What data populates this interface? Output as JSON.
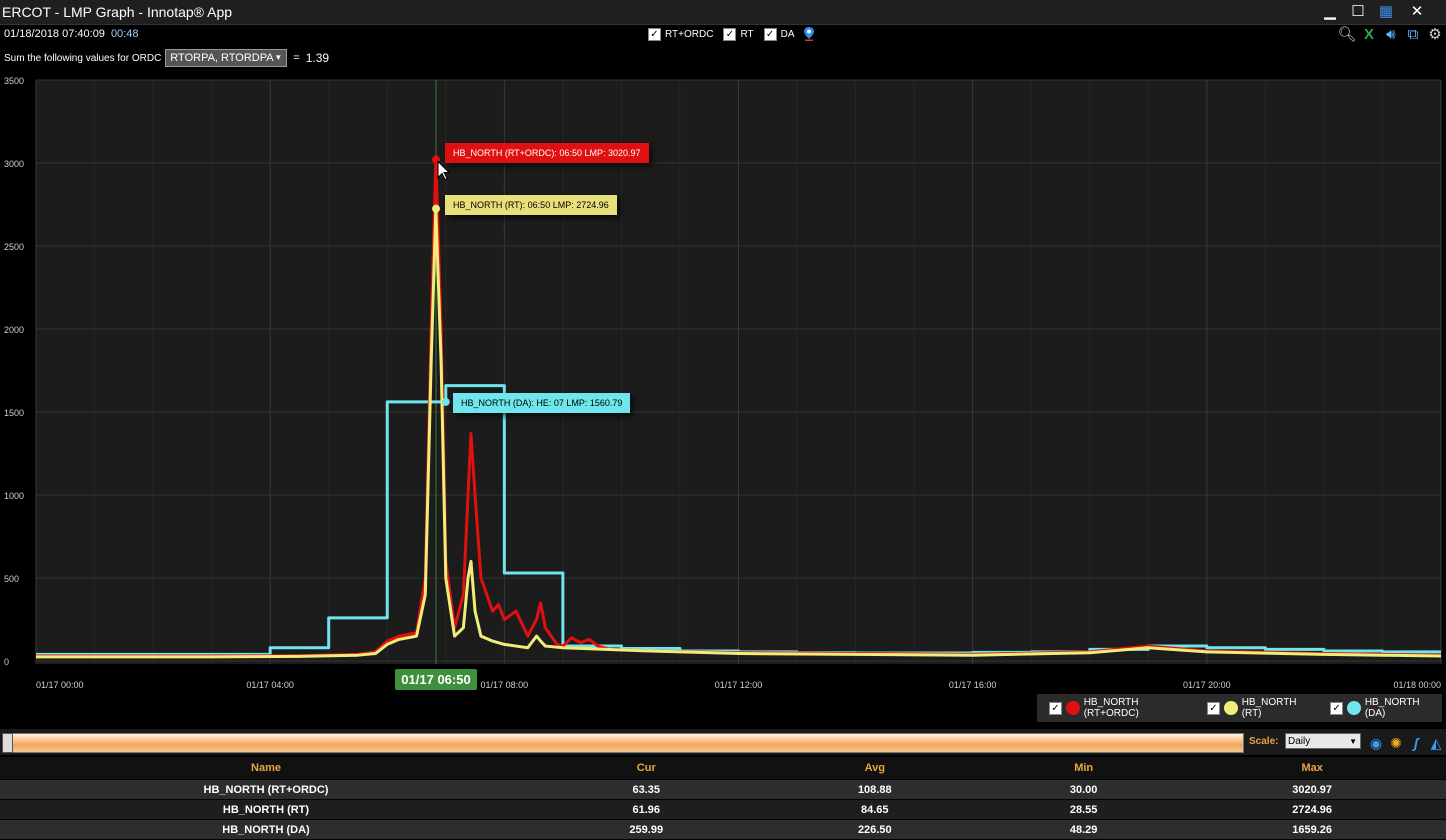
{
  "window": {
    "title": "ERCOT - LMP Graph - Innotap® App",
    "minimize": "▁",
    "maximize": "☐",
    "tile": "▦",
    "close": "✕"
  },
  "toolbar": {
    "datetime": "01/18/2018 07:40:09",
    "elapsed": "00:48",
    "checks": [
      {
        "label": "RT+ORDC",
        "checked": true
      },
      {
        "label": "RT",
        "checked": true
      },
      {
        "label": "DA",
        "checked": true
      }
    ],
    "ordc_label": "Sum the following values for ORDC",
    "ordc_selected": "RTORPA, RTORDPA",
    "equals": "=",
    "ordc_sum": "1.39",
    "icons": [
      "search-icon",
      "excel-icon",
      "sound-icon",
      "export-icon",
      "settings-icon"
    ]
  },
  "hover": {
    "time_label": "01/17 06:50",
    "tooltips": {
      "rt_ordc": "HB_NORTH (RT+ORDC): 06:50 LMP: 3020.97",
      "rt": "HB_NORTH (RT): 06:50 LMP: 2724.96",
      "da": "HB_NORTH (DA): HE: 07 LMP: 1560.79"
    }
  },
  "chart_data": {
    "type": "line",
    "title": "",
    "xlabel": "",
    "ylabel": "",
    "xlim_hours": [
      0,
      24
    ],
    "ylim": [
      0,
      3500
    ],
    "yticks": [
      0,
      500,
      1000,
      1500,
      2000,
      2500,
      3000,
      3500
    ],
    "xticks": [
      {
        "h": 0,
        "label": "01/17 00:00"
      },
      {
        "h": 4,
        "label": "01/17 04:00"
      },
      {
        "h": 8,
        "label": "01/17 08:00"
      },
      {
        "h": 12,
        "label": "01/17 12:00"
      },
      {
        "h": 16,
        "label": "01/17 16:00"
      },
      {
        "h": 20,
        "label": "01/17 20:00"
      },
      {
        "h": 24,
        "label": "01/18 00:00"
      }
    ],
    "grid": true,
    "legend_position": "bottom-right",
    "series": [
      {
        "name": "HB_NORTH (RT+ORDC)",
        "color": "#e01010",
        "step": false,
        "points": [
          [
            0,
            30
          ],
          [
            3,
            30
          ],
          [
            4.5,
            32
          ],
          [
            5.5,
            40
          ],
          [
            5.8,
            55
          ],
          [
            6.0,
            120
          ],
          [
            6.2,
            150
          ],
          [
            6.5,
            170
          ],
          [
            6.65,
            500
          ],
          [
            6.75,
            2000
          ],
          [
            6.83,
            3020.97
          ],
          [
            6.92,
            2000
          ],
          [
            7.0,
            600
          ],
          [
            7.15,
            200
          ],
          [
            7.3,
            400
          ],
          [
            7.38,
            1000
          ],
          [
            7.43,
            1370
          ],
          [
            7.5,
            1000
          ],
          [
            7.6,
            500
          ],
          [
            7.7,
            400
          ],
          [
            7.8,
            300
          ],
          [
            7.9,
            340
          ],
          [
            8.0,
            250
          ],
          [
            8.2,
            300
          ],
          [
            8.4,
            150
          ],
          [
            8.55,
            250
          ],
          [
            8.62,
            350
          ],
          [
            8.7,
            200
          ],
          [
            8.9,
            100
          ],
          [
            9.0,
            90
          ],
          [
            9.15,
            140
          ],
          [
            9.3,
            110
          ],
          [
            9.45,
            130
          ],
          [
            9.6,
            90
          ],
          [
            9.8,
            70
          ],
          [
            10.5,
            60
          ],
          [
            12,
            50
          ],
          [
            14,
            45
          ],
          [
            16,
            40
          ],
          [
            18,
            55
          ],
          [
            19,
            90
          ],
          [
            20,
            60
          ],
          [
            22,
            45
          ],
          [
            23,
            40
          ],
          [
            24,
            35
          ]
        ]
      },
      {
        "name": "HB_NORTH (RT)",
        "color": "#f1ed79",
        "step": false,
        "points": [
          [
            0,
            25
          ],
          [
            3,
            25
          ],
          [
            4.5,
            28
          ],
          [
            5.5,
            35
          ],
          [
            5.8,
            45
          ],
          [
            6.0,
            100
          ],
          [
            6.2,
            130
          ],
          [
            6.5,
            150
          ],
          [
            6.65,
            400
          ],
          [
            6.75,
            1800
          ],
          [
            6.83,
            2724.96
          ],
          [
            6.92,
            1800
          ],
          [
            7.0,
            500
          ],
          [
            7.15,
            150
          ],
          [
            7.3,
            200
          ],
          [
            7.38,
            500
          ],
          [
            7.43,
            600
          ],
          [
            7.5,
            300
          ],
          [
            7.6,
            150
          ],
          [
            7.8,
            120
          ],
          [
            8.0,
            100
          ],
          [
            8.2,
            90
          ],
          [
            8.4,
            80
          ],
          [
            8.55,
            150
          ],
          [
            8.62,
            120
          ],
          [
            8.7,
            90
          ],
          [
            9.0,
            80
          ],
          [
            10.5,
            60
          ],
          [
            12,
            45
          ],
          [
            14,
            40
          ],
          [
            16,
            35
          ],
          [
            18,
            50
          ],
          [
            19,
            80
          ],
          [
            20,
            55
          ],
          [
            22,
            40
          ],
          [
            23,
            35
          ],
          [
            24,
            30
          ]
        ]
      },
      {
        "name": "HB_NORTH (DA)",
        "color": "#6ee6ec",
        "step": true,
        "points": [
          [
            0,
            40
          ],
          [
            3,
            40
          ],
          [
            4,
            80
          ],
          [
            5,
            260
          ],
          [
            6,
            1560.79
          ],
          [
            7,
            1659.26
          ],
          [
            8,
            530
          ],
          [
            9,
            90
          ],
          [
            10,
            75
          ],
          [
            11,
            60
          ],
          [
            12,
            55
          ],
          [
            13,
            50
          ],
          [
            14,
            48
          ],
          [
            15,
            48.29
          ],
          [
            16,
            52
          ],
          [
            17,
            55
          ],
          [
            18,
            70
          ],
          [
            19,
            90
          ],
          [
            20,
            80
          ],
          [
            21,
            70
          ],
          [
            22,
            60
          ],
          [
            23,
            55
          ],
          [
            24,
            55
          ]
        ]
      }
    ]
  },
  "legend": [
    {
      "name": "HB_NORTH (RT+ORDC)",
      "color": "#e01010"
    },
    {
      "name": "HB_NORTH (RT)",
      "color": "#f1ed79"
    },
    {
      "name": "HB_NORTH (DA)",
      "color": "#6ee6ec"
    }
  ],
  "range": {
    "scale_label": "Scale:",
    "scale_value": "Daily"
  },
  "stats": {
    "headers": [
      "Name",
      "Cur",
      "Avg",
      "Min",
      "Max"
    ],
    "rows": [
      [
        "HB_NORTH (RT+ORDC)",
        "63.35",
        "108.88",
        "30.00",
        "3020.97"
      ],
      [
        "HB_NORTH (RT)",
        "61.96",
        "84.65",
        "28.55",
        "2724.96"
      ],
      [
        "HB_NORTH (DA)",
        "259.99",
        "226.50",
        "48.29",
        "1659.26"
      ]
    ]
  }
}
